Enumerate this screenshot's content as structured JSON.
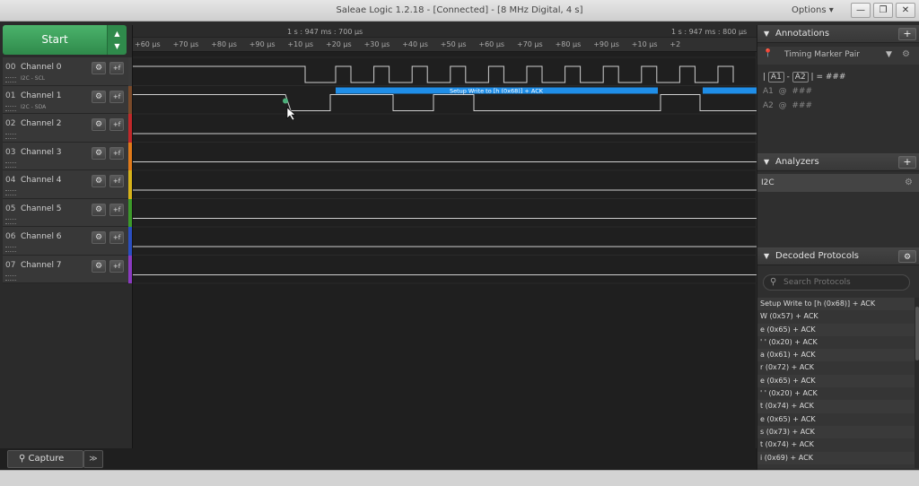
{
  "window": {
    "title": "Saleae Logic 1.2.18 - [Connected] - [8 MHz Digital, 4 s]",
    "options_label": "Options ▾",
    "minimize": "—",
    "restore": "❐",
    "close": "✕"
  },
  "start": {
    "label": "Start",
    "arrows_up": "▲",
    "arrows_down": "▼"
  },
  "channels": [
    {
      "num": "00",
      "name": "Channel 0",
      "sub": "I2C - SCL",
      "color": "#3a3a3a"
    },
    {
      "num": "01",
      "name": "Channel 1",
      "sub": "I2C - SDA",
      "color": "#7a4a2a"
    },
    {
      "num": "02",
      "name": "Channel 2",
      "sub": "",
      "color": "#c0282a"
    },
    {
      "num": "03",
      "name": "Channel 3",
      "sub": "",
      "color": "#e07a1a"
    },
    {
      "num": "04",
      "name": "Channel 4",
      "sub": "",
      "color": "#d6b21a"
    },
    {
      "num": "05",
      "name": "Channel 5",
      "sub": "",
      "color": "#3c9a2a"
    },
    {
      "num": "06",
      "name": "Channel 6",
      "sub": "",
      "color": "#2a4ec0"
    },
    {
      "num": "07",
      "name": "Channel 7",
      "sub": "",
      "color": "#8a3ac0"
    }
  ],
  "channel_buttons": {
    "gear": "⚙",
    "trigger": "+f"
  },
  "ruler": {
    "center_label": "1 s : 947 ms : 700 μs",
    "right_label": "1 s : 947 ms : 800 μs",
    "ticks": [
      "+60 μs",
      "+70 μs",
      "+80 μs",
      "+90 μs",
      "+10 μs",
      "+20 μs",
      "+30 μs",
      "+40 μs",
      "+50 μs",
      "+60 μs",
      "+70 μs",
      "+80 μs",
      "+90 μs",
      "+10 μs",
      "+2"
    ]
  },
  "decode_bar": {
    "label": "Setup Write to [h (0x68)] + ACK",
    "color": "#1f8ee8"
  },
  "capture_tab": {
    "label": "Capture",
    "more": "≫"
  },
  "annotations": {
    "title": "Annotations",
    "add": "+",
    "marker": "Timing Marker Pair",
    "row_main": {
      "a1": "A1",
      "a2": "A2",
      "value": "= ###"
    },
    "rows": [
      {
        "label": "A1",
        "at": "@",
        "value": "###"
      },
      {
        "label": "A2",
        "at": "@",
        "value": "###"
      }
    ]
  },
  "analyzers": {
    "title": "Analyzers",
    "add": "+",
    "items": [
      "I2C"
    ]
  },
  "decoded": {
    "title": "Decoded Protocols",
    "search_placeholder": "Search Protocols",
    "rows": [
      "Setup Write to [h (0x68)] + ACK",
      "W (0x57) + ACK",
      "e (0x65) + ACK",
      "' ' (0x20) + ACK",
      "a (0x61) + ACK",
      "r (0x72) + ACK",
      "e (0x65) + ACK",
      "' ' (0x20) + ACK",
      "t (0x74) + ACK",
      "e (0x65) + ACK",
      "s (0x73) + ACK",
      "t (0x74) + ACK",
      "i (0x69) + ACK"
    ]
  }
}
